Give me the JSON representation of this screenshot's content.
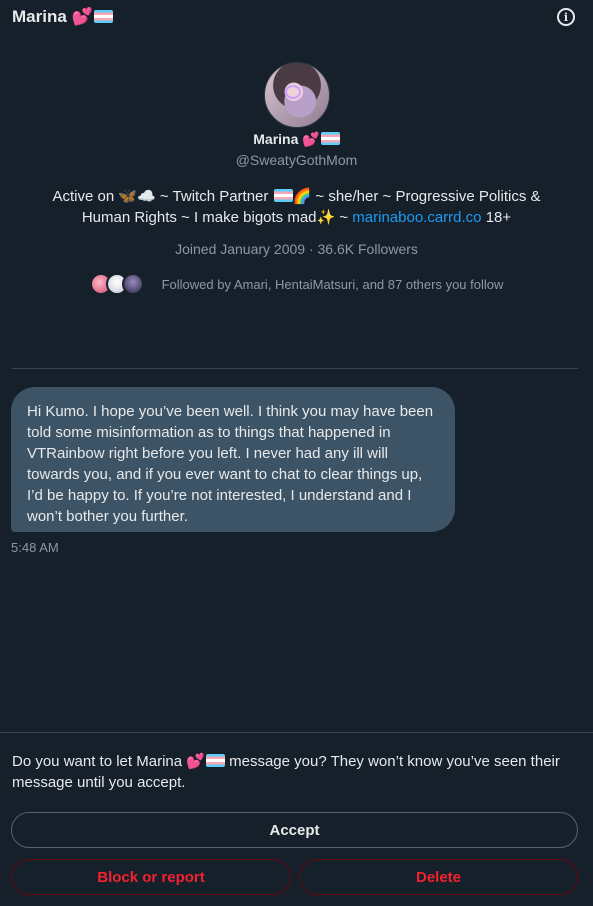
{
  "header": {
    "title": "Marina",
    "heart": "💕",
    "info_icon": "info-icon"
  },
  "profile": {
    "name": "Marina",
    "heart": "💕",
    "handle": "@SweatyGothMom",
    "bio_part1": "Active on 🦋☁️ ~ Twitch Partner ",
    "bio_part2": "🌈 ~ she/her ~ Progressive Politics & Human Rights ~ I make bigots mad✨ ~ ",
    "bio_link": "marinaboo.carrd.co",
    "bio_part3": " 18+",
    "joined": "Joined January 2009 · 36.6K Followers",
    "followed_by": "Followed by Amari, HentaiMatsuri, and 87 others you follow"
  },
  "message": {
    "text": "Hi Kumo. I hope you’ve been well. I think you may have been told some misinformation as to things that happened in VTRainbow right before you left. I never had any ill will towards you, and if you ever want to chat to clear things up, I’d be happy to. If you’re not interested, I understand and I won’t bother you further.",
    "time": "5:48 AM"
  },
  "request": {
    "prompt_part1": "Do you want to let Marina ",
    "heart": "💕",
    "prompt_part2": " message you? They won’t know you’ve seen their message until you accept.",
    "accept_label": "Accept",
    "block_label": "Block or report",
    "delete_label": "Delete"
  },
  "colors": {
    "background": "#15202b",
    "bubble": "#3d5466",
    "link": "#1d9bf0",
    "danger": "#f4212e"
  }
}
